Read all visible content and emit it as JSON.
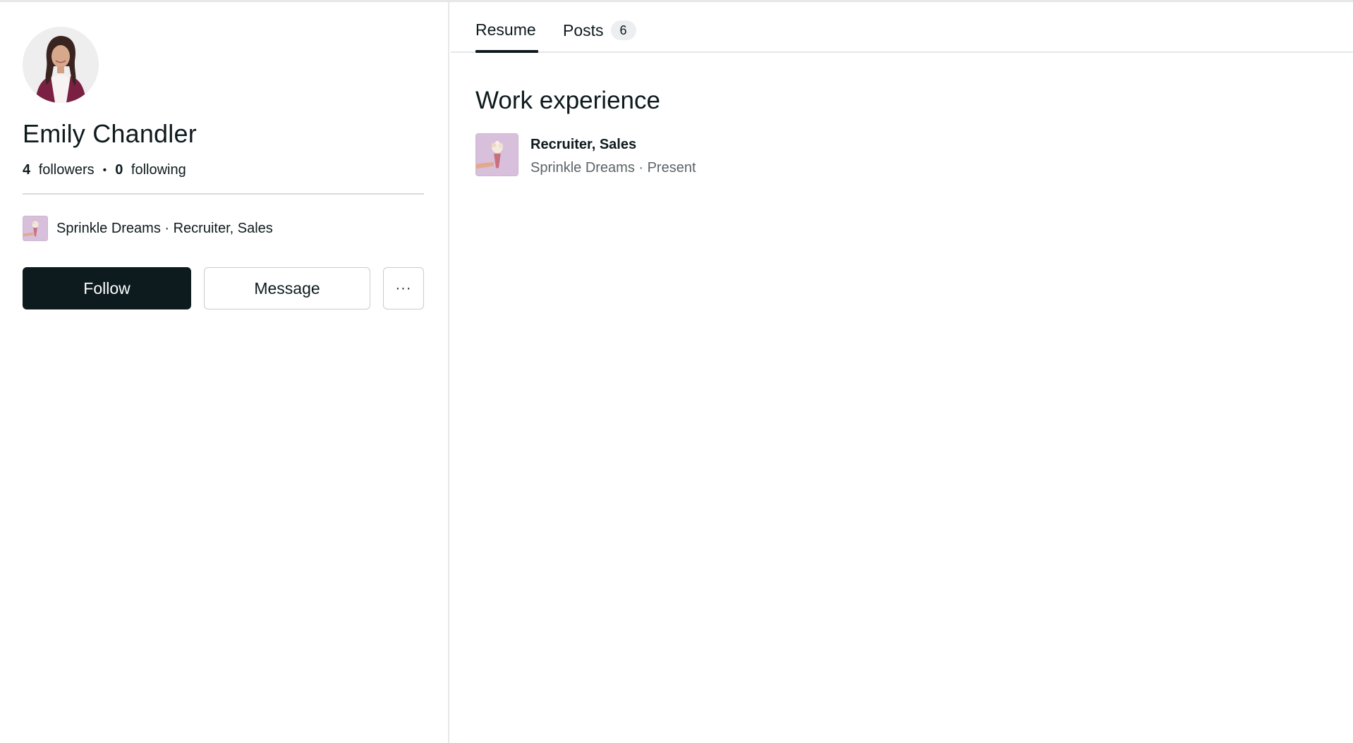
{
  "profile": {
    "name": "Emily Chandler",
    "followers_count": "4",
    "followers_label": "followers",
    "following_count": "0",
    "following_label": "following",
    "separator": "•",
    "company_line": "Sprinkle Dreams · Recruiter, Sales"
  },
  "actions": {
    "follow_label": "Follow",
    "message_label": "Message",
    "more_label": "···"
  },
  "tabs": [
    {
      "label": "Resume",
      "active": true
    },
    {
      "label": "Posts",
      "count": "6",
      "active": false
    }
  ],
  "work_experience": {
    "title": "Work experience",
    "items": [
      {
        "role": "Recruiter, Sales",
        "company_period": "Sprinkle Dreams · Present",
        "logo_icon": "company-logo-icon"
      }
    ]
  },
  "colors": {
    "primary_button": "#0d1a1e",
    "logo_bg": "#d8bfdc",
    "border": "#e6e7e8"
  }
}
